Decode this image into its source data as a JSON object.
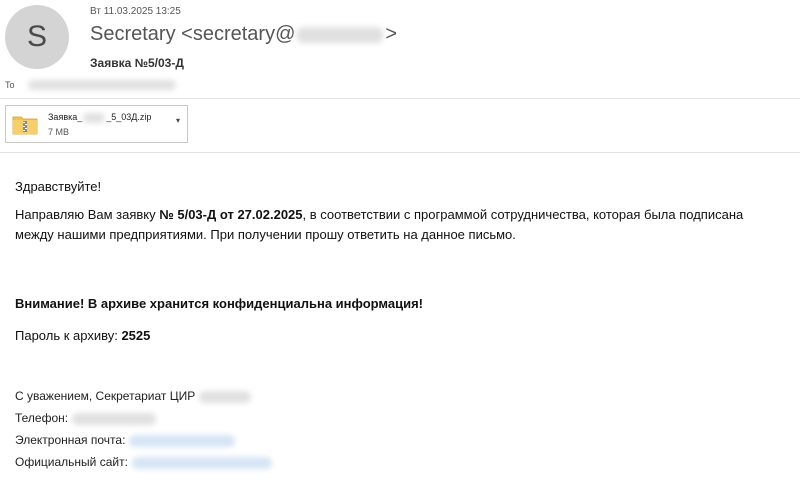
{
  "email": {
    "sender_initial": "S",
    "date": "Вт 11.03.2025 13:25",
    "sender_name": "Secretary",
    "sender_email_prefix": "<secretary@",
    "sender_email_suffix": ">",
    "subject": "Заявка №5/03-Д",
    "to_label": "To"
  },
  "attachment": {
    "name_prefix": "Заявка_",
    "name_suffix": "_5_03Д.zip",
    "size": "7 MB",
    "dropdown_icon": "▾"
  },
  "body": {
    "greeting": "Здравствуйте!",
    "para_part1": "Направляю Вам заявку ",
    "para_bold": "№ 5/03-Д от 27.02.2025",
    "para_part2": ", в соответствии с программой сотрудничества, которая была подписана между нашими предприятиями. При получении прошу ответить на данное письмо.",
    "warning": "Внимание! В архиве хранится конфиденциальна информация!",
    "password_label": "Пароль к архиву: ",
    "password_value": "2525"
  },
  "signature": {
    "regards": "С уважением, Секретариат ЦИР",
    "phone_label": "Телефон:",
    "email_label": "Электронная почта:",
    "site_label": "Официальный сайт:"
  },
  "colors": {
    "avatar_bg": "#d4d4d4",
    "zip_folder": "#f2c14e",
    "divider": "#e2e2e2"
  },
  "icons": {
    "attachment": "zip-folder-icon",
    "dropdown": "chevron-down-icon"
  }
}
